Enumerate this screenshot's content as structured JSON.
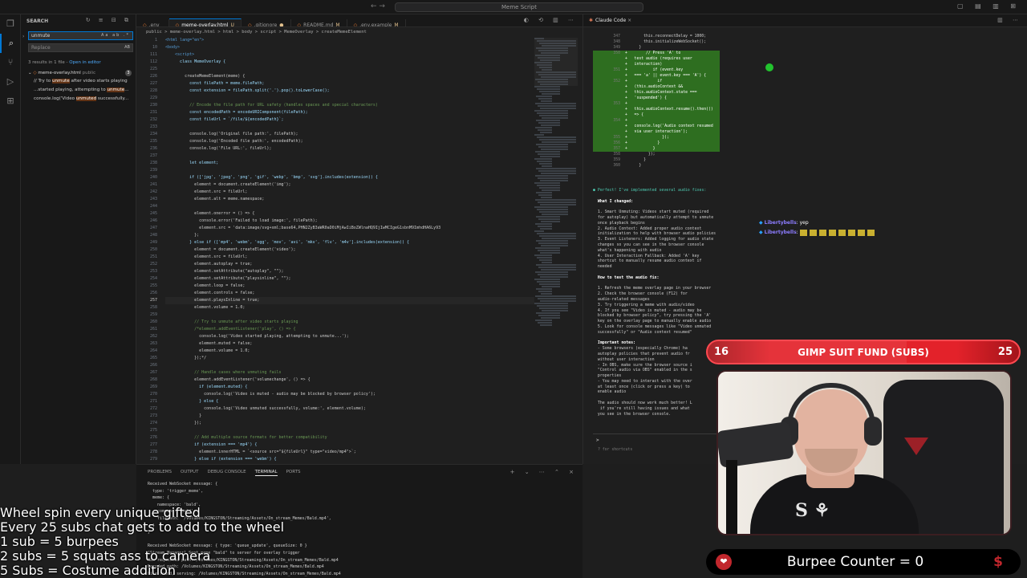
{
  "titlebar": {
    "command_center": "Meme Script",
    "nav": "←  →"
  },
  "activity": [
    "files-icon",
    "search-icon",
    "source-control-icon",
    "run-debug-icon",
    "extensions-icon"
  ],
  "sidebar": {
    "title": "SEARCH",
    "search_value": "unmute",
    "search_opts": "Aa  ab  .*",
    "replace_placeholder": "Replace",
    "replace_opts": "AB",
    "results_summary": "3 results in 1 file - ",
    "open_in_editor": "Open in editor",
    "file_name": "meme-overlay.html",
    "file_path": "public",
    "file_count": "3",
    "matches": [
      {
        "pre": "// Try to ",
        "hit": "unmute",
        "post": " after video starts playing"
      },
      {
        "pre": "...started playing, attempting to ",
        "hit": "unmute",
        "post": "..."
      },
      {
        "pre": "console.log('Video ",
        "hit": "unmuted",
        "post": " successfully..."
      }
    ]
  },
  "tabs": [
    {
      "label": ".env",
      "mod": "",
      "active": false
    },
    {
      "label": "meme-overlay.html",
      "mod": "U",
      "active": true
    },
    {
      "label": ".gitignore",
      "mod": "●",
      "active": false
    },
    {
      "label": "README.md",
      "mod": "M",
      "active": false
    },
    {
      "label": ".env.example",
      "mod": "M",
      "active": false
    }
  ],
  "breadcrumbs": "public  >  meme-overlay.html  >  html  >  body  >  script  >  MemeOverlay  >  createMemeElement",
  "editor": {
    "lines": [
      [
        "1",
        "<html lang=\"en\">"
      ],
      [
        "10",
        "<body>"
      ],
      [
        "111",
        "    <script>"
      ],
      [
        "112",
        "      class MemeOverlay {"
      ],
      [
        "225",
        ""
      ],
      [
        "226",
        "        createMemeElement(meme) {"
      ],
      [
        "227",
        "          const filePath = meme.filePath;"
      ],
      [
        "228",
        "          const extension = filePath.split('.').pop().toLowerCase();"
      ],
      [
        "229",
        ""
      ],
      [
        "230",
        "          // Encode the file path for URL safety (handles spaces and special characters)"
      ],
      [
        "231",
        "          const encodedPath = encodeURIComponent(filePath);"
      ],
      [
        "232",
        "          const fileUrl = `/file/${encodedPath}`;"
      ],
      [
        "233",
        ""
      ],
      [
        "234",
        "          console.log('Original file path:', filePath);"
      ],
      [
        "235",
        "          console.log('Encoded file path:', encodedPath);"
      ],
      [
        "236",
        "          console.log('File URL:', fileUrl);"
      ],
      [
        "237",
        ""
      ],
      [
        "238",
        "          let element;"
      ],
      [
        "239",
        ""
      ],
      [
        "240",
        "          if (['jpg', 'jpeg', 'png', 'gif', 'webp', 'bmp', 'svg'].includes(extension)) {"
      ],
      [
        "241",
        "            element = document.createElement('img');"
      ],
      [
        "242",
        "            element.src = fileUrl;"
      ],
      [
        "243",
        "            element.alt = meme.namespace;"
      ],
      [
        "244",
        ""
      ],
      [
        "245",
        "            element.onerror = () => {"
      ],
      [
        "246",
        "              console.error('Failed to load image:', filePath);"
      ],
      [
        "247",
        "              element.src = 'data:image/svg+xml;base64,PHN2ZyB3aWR0aD0iMjAwIiBoZWlnaHQ9IjIwMCIgeG1sbnM9ImhdHA6Ly93"
      ],
      [
        "248",
        "            };"
      ],
      [
        "249",
        "          } else if (['mp4', 'webm', 'ogg', 'mov', 'avi', 'mkv', 'flv', 'm4v'].includes(extension)) {"
      ],
      [
        "250",
        "            element = document.createElement('video');"
      ],
      [
        "251",
        "            element.src = fileUrl;"
      ],
      [
        "252",
        "            element.autoplay = true;"
      ],
      [
        "253",
        "            element.setAttribute(\"autoplay\", \"\");"
      ],
      [
        "254",
        "            element.setAttribute(\"playsinline\", \"\");"
      ],
      [
        "255",
        "            element.loop = false;"
      ],
      [
        "256",
        "            element.controls = false;"
      ],
      [
        "257",
        "            element.playsInline = true;"
      ],
      [
        "258",
        "            element.volume = 1.0;"
      ],
      [
        "259",
        ""
      ],
      [
        "260",
        "            // Try to unmute after video starts playing"
      ],
      [
        "261",
        "            /*element.addEventListener('play', () => {"
      ],
      [
        "262",
        "              console.log('Video started playing, attempting to unmute...');"
      ],
      [
        "263",
        "              element.muted = false;"
      ],
      [
        "264",
        "              element.volume = 1.0;"
      ],
      [
        "265",
        "            });*/"
      ],
      [
        "266",
        ""
      ],
      [
        "267",
        "            // Handle cases where unmuting fails"
      ],
      [
        "268",
        "            element.addEventListener('volumechange', () => {"
      ],
      [
        "269",
        "              if (element.muted) {"
      ],
      [
        "270",
        "                console.log('Video is muted - audio may be blocked by browser policy');"
      ],
      [
        "271",
        "              } else {"
      ],
      [
        "272",
        "                console.log('Video unmuted successfully, volume:', element.volume);"
      ],
      [
        "273",
        "              }"
      ],
      [
        "274",
        "            });"
      ],
      [
        "275",
        ""
      ],
      [
        "276",
        "            // Add multiple source formats for better compatibility"
      ],
      [
        "277",
        "            if (extension === 'mp4') {"
      ],
      [
        "278",
        "              element.innerHTML = `<source src=\"${fileUrl}\" type=\"video/mp4\">`;"
      ],
      [
        "279",
        "            } else if (extension === 'webm') {"
      ]
    ],
    "current_line": "257"
  },
  "panel": {
    "tabs": [
      "PROBLEMS",
      "OUTPUT",
      "DEBUG CONSOLE",
      "TERMINAL",
      "PORTS"
    ],
    "active_tab": "TERMINAL",
    "terminal": [
      "Received WebSocket message: {",
      "  type: 'trigger_meme',",
      "  meme: {",
      "    namespace: 'bald',",
      "    command: 'bald',",
      "    filePath: '/Volumes/KINGSTON/Streaming/Assets/On_stream_Memes/Bald.mp4',",
      "  }",
      "}",
      "",
      "Received WebSocket message: { type: 'queue_update', queueSize: 0 }",
      "[Stream Manager] Sent meme \"bald\" to server for overlay trigger",
      "Raw requested path: /Volumes/KINGSTON/Streaming/Assets/On_stream_Memes/Bald.mp4",
      "Decoded path: /Volumes/KINGSTON/Streaming/Assets/On_stream_Memes/Bald.mp4",
      "File found, serving: /Volumes/KINGSTON/Streaming/Assets/On_stream_Memes/Bald.mp4"
    ]
  },
  "claude": {
    "tab_label": "Claude Code",
    "diff": [
      [
        "347",
        "ctx",
        "        this.reconnectDelay = 1000;"
      ],
      [
        "348",
        "ctx",
        "        this.initializeWebSocket();"
      ],
      [
        "349",
        "ctx",
        "      }"
      ],
      [
        "350",
        "add",
        "+        // Press 'A' to"
      ],
      [
        "",
        "add",
        "+   test audio (requires user"
      ],
      [
        "",
        "add",
        "+   interaction)"
      ],
      [
        "351",
        "add",
        "+           if (event.key"
      ],
      [
        "",
        "add",
        "+   === 'a' || event.key === 'A') {"
      ],
      [
        "352",
        "add",
        "+             if"
      ],
      [
        "",
        "add",
        "+   (this.audioContext &&"
      ],
      [
        "",
        "add",
        "+   this.audioContext.state ==="
      ],
      [
        "",
        "add",
        "+   'suspended') {"
      ],
      [
        "353",
        "add",
        "+"
      ],
      [
        "",
        "add",
        "+   this.audioContext.resume().then(()"
      ],
      [
        "",
        "add",
        "+   => {"
      ],
      [
        "354",
        "add",
        "+"
      ],
      [
        "",
        "add",
        "+   console.log('Audio context resumed"
      ],
      [
        "",
        "add",
        "+   via user interaction');"
      ],
      [
        "355",
        "add",
        "+               });"
      ],
      [
        "356",
        "add",
        "+             }"
      ],
      [
        "357",
        "add",
        "+           }"
      ],
      [
        "358",
        "ctx",
        "          });"
      ],
      [
        "359",
        "ctx",
        "        }"
      ],
      [
        "360",
        "ctx",
        "      }"
      ]
    ],
    "text": [
      [
        "dot",
        "● Perfect! I've implemented several audio fixes:"
      ],
      [
        "",
        ""
      ],
      [
        "b",
        "  What I changed:"
      ],
      [
        "",
        ""
      ],
      [
        "",
        "  1. Smart Unmuting: Videos start muted (required"
      ],
      [
        "",
        "  for autoplay) but automatically attempt to unmute"
      ],
      [
        "",
        "  once playback begins"
      ],
      [
        "",
        "  2. Audio Context: Added proper audio context"
      ],
      [
        "",
        "  initialization to help with browser audio policies"
      ],
      [
        "",
        "  3. Event Listeners: Added logging for audio state"
      ],
      [
        "",
        "  changes so you can see in the browser console"
      ],
      [
        "",
        "  what's happening with audio"
      ],
      [
        "",
        "  4. User Interaction Fallback: Added 'A' key"
      ],
      [
        "",
        "  shortcut to manually resume audio context if"
      ],
      [
        "",
        "  needed"
      ],
      [
        "",
        ""
      ],
      [
        "b",
        "  How to test the audio fix:"
      ],
      [
        "",
        ""
      ],
      [
        "",
        "  1. Refresh the meme overlay page in your browser"
      ],
      [
        "",
        "  2. Check the browser console (F12) for"
      ],
      [
        "",
        "  audio-related messages"
      ],
      [
        "",
        "  3. Try triggering a meme with audio/video"
      ],
      [
        "",
        "  4. If you see \"Video is muted - audio may be"
      ],
      [
        "",
        "  blocked by browser policy\", try pressing the 'A'"
      ],
      [
        "",
        "  key on the overlay page to manually enable audio"
      ],
      [
        "",
        "  5. Look for console messages like \"Video unmuted"
      ],
      [
        "",
        "  successfully\" or \"Audio context resumed\""
      ],
      [
        "",
        ""
      ],
      [
        "b",
        "  Important notes:"
      ],
      [
        "",
        "  - Some browsers (especially Chrome) ha"
      ],
      [
        "",
        "  autoplay policies that prevent audio fr"
      ],
      [
        "",
        "  without user interaction"
      ],
      [
        "",
        "  - In OBS, make sure the browser source i"
      ],
      [
        "",
        "  \"Control audio via OBS\" enabled in the s"
      ],
      [
        "",
        "  properties"
      ],
      [
        "",
        "  - You may need to interact with the over"
      ],
      [
        "",
        "  at least once (click or press a key) to"
      ],
      [
        "",
        "  enable audio"
      ],
      [
        "",
        ""
      ],
      [
        "",
        "  The audio should now work much better! L"
      ],
      [
        "",
        "   if you're still having issues and what"
      ],
      [
        "",
        "  you see in the browser console."
      ]
    ],
    "prompt_caret": ">",
    "prompt_hint": "? for shortcuts"
  },
  "chat": [
    {
      "user": "Libertybells",
      "msg": "yep"
    },
    {
      "user": "Libertybells",
      "msg": ""
    }
  ],
  "sub_goal": {
    "current": "16",
    "label": "GIMP SUIT FUND (SUBS)",
    "target": "25",
    "progress": 0.64
  },
  "burpee": {
    "label": "Burpee Counter = 0",
    "heart": "❤",
    "dollar": "$"
  },
  "rules": [
    "Wheel spin every unique gifted",
    "Every 25 subs chat gets to add to the wheel",
    "1 sub = 5 burpees",
    "2 subs = 5 squats ass to camera",
    "5 Subs = Costume addition"
  ],
  "colors": {
    "accent": "#0078d4",
    "diff_add": "#2e6e20",
    "sub_bar": "#e3222a",
    "cursor": "#22c32e"
  }
}
